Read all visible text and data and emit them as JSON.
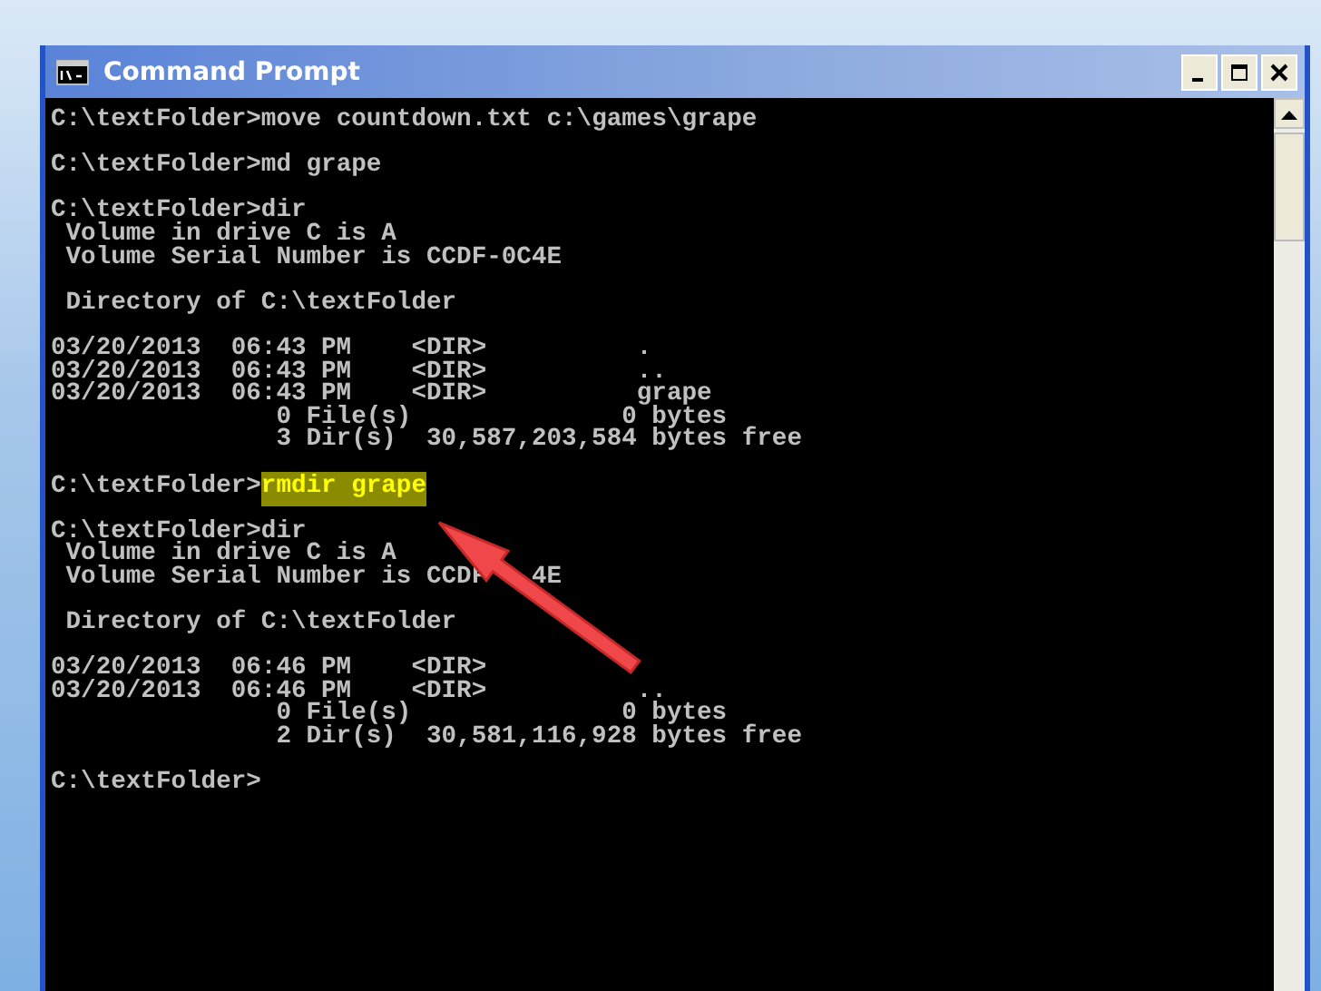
{
  "window": {
    "title": "Command Prompt"
  },
  "console": {
    "blocks": [
      [
        {
          "kind": "command",
          "prompt": "C:\\textFolder>",
          "command": "move countdown.txt c:\\games\\grape",
          "highlighted": false
        }
      ],
      [
        {
          "kind": "command",
          "prompt": "C:\\textFolder>",
          "command": "md grape",
          "highlighted": false
        }
      ],
      [
        {
          "kind": "command",
          "prompt": "C:\\textFolder>",
          "command": "dir",
          "highlighted": false
        },
        {
          "kind": "output",
          "text": " Volume in drive C is A"
        },
        {
          "kind": "output",
          "text": " Volume Serial Number is CCDF-0C4E"
        }
      ],
      [
        {
          "kind": "output",
          "text": " Directory of C:\\textFolder"
        }
      ],
      [
        {
          "kind": "output",
          "text": "03/20/2013  06:43 PM    <DIR>          ."
        },
        {
          "kind": "output",
          "text": "03/20/2013  06:43 PM    <DIR>          .."
        },
        {
          "kind": "output",
          "text": "03/20/2013  06:43 PM    <DIR>          grape"
        },
        {
          "kind": "output",
          "text": "               0 File(s)              0 bytes"
        },
        {
          "kind": "output",
          "text": "               3 Dir(s)  30,587,203,584 bytes free"
        }
      ],
      [
        {
          "kind": "command",
          "prompt": "C:\\textFolder>",
          "command": "rmdir grape",
          "highlighted": true
        }
      ],
      [
        {
          "kind": "command",
          "prompt": "C:\\textFolder>",
          "command": "dir",
          "highlighted": false
        },
        {
          "kind": "output",
          "text": " Volume in drive C is A"
        },
        {
          "kind": "output",
          "text": " Volume Serial Number is CCDF   4E"
        }
      ],
      [
        {
          "kind": "output",
          "text": " Directory of C:\\textFolder"
        }
      ],
      [
        {
          "kind": "output",
          "text": "03/20/2013  06:46 PM    <DIR>"
        },
        {
          "kind": "output",
          "text": "03/20/2013  06:46 PM    <DIR>          .."
        },
        {
          "kind": "output",
          "text": "               0 File(s)              0 bytes"
        },
        {
          "kind": "output",
          "text": "               2 Dir(s)  30,581,116,928 bytes free"
        }
      ],
      [
        {
          "kind": "command",
          "prompt": "C:\\textFolder>"
        }
      ]
    ]
  }
}
